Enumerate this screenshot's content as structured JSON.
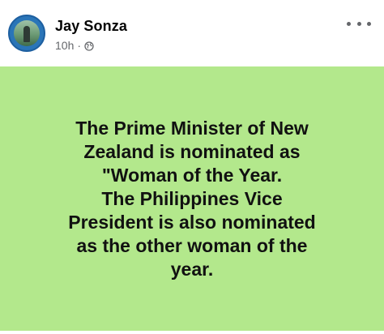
{
  "post": {
    "author_name": "Jay Sonza",
    "timestamp": "10h",
    "separator": "·",
    "privacy_icon": "globe-icon",
    "more_icon": "more-options-icon",
    "background_color": "#b3e88c",
    "body_text": "The Prime Minister of New\nZealand is nominated as\n\"Woman of the Year.\nThe Philippines Vice\nPresident is also nominated\nas the other woman of the\nyear."
  }
}
